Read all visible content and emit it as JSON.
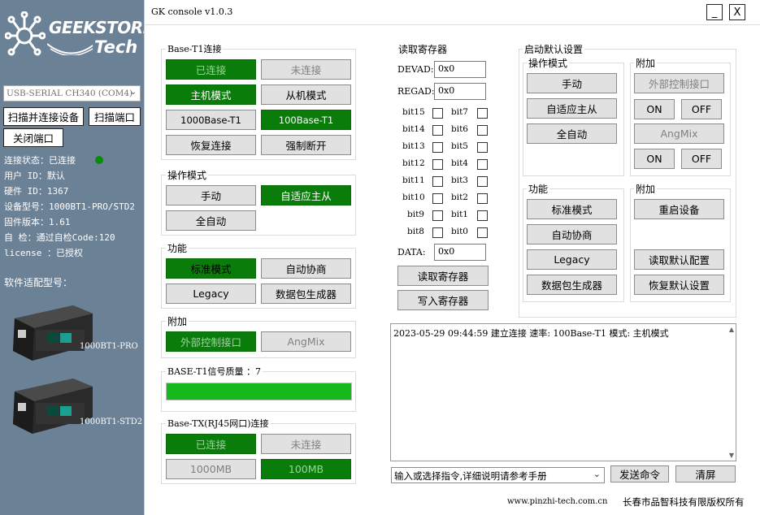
{
  "brand": {
    "line1": "GEEKSTORE",
    "line2": "Tech"
  },
  "window": {
    "title": "GK console v1.0.3",
    "minimize": "_",
    "close": "X"
  },
  "sidebar": {
    "port_select": "USB-SERIAL CH340 (COM4)",
    "scan_connect": "扫描并连接设备",
    "scan_port": "扫描端口",
    "close_port": "关闭端口",
    "info": [
      {
        "k": "连接状态",
        "v": "：已连接"
      },
      {
        "k": "用户  ID",
        "v": "：默认"
      },
      {
        "k": "硬件  ID",
        "v": "：1367"
      },
      {
        "k": "设备型号",
        "v": "：1000BT1-PRO/STD2"
      },
      {
        "k": "固件版本",
        "v": "：1.61"
      },
      {
        "k": "自    检",
        "v": "：通过自检Code:120"
      },
      {
        "k": "license ",
        "v": "：已授权"
      }
    ],
    "models_title": "软件适配型号：",
    "model1": "1000BT1-PRO",
    "model2": "1000BT1-STD2"
  },
  "base_t1": {
    "title": "Base-T1连接",
    "connected": "已连接",
    "disconnected": "未连接",
    "master": "主机模式",
    "slave": "从机模式",
    "speed1000": "1000Base-T1",
    "speed100": "100Base-T1",
    "restore": "恢复连接",
    "force_off": "强制断开"
  },
  "op_mode": {
    "title": "操作模式",
    "manual": "手动",
    "adaptive": "自适应主从",
    "auto": "全自动"
  },
  "func": {
    "title": "功能",
    "standard": "标准模式",
    "autoneg": "自动协商",
    "legacy": "Legacy",
    "pktgen": "数据包生成器"
  },
  "extra": {
    "title": "附加",
    "ext_ctrl": "外部控制接口",
    "angmix": "AngMix"
  },
  "signal": {
    "title": "BASE-T1信号质量 ：7",
    "level": 1.0
  },
  "base_tx": {
    "title": "Base-TX(RJ45网口)连接",
    "connected": "已连接",
    "disconnected": "未连接",
    "speed1000": "1000MB",
    "speed100": "100MB"
  },
  "reg": {
    "title": "读取寄存器",
    "devad_label": "DEVAD:",
    "devad": "0x0",
    "regad_label": "REGAD:",
    "regad": "0x0",
    "bits_left": [
      "bit15",
      "bit14",
      "bit13",
      "bit12",
      "bit11",
      "bit10",
      "bit9",
      "bit8"
    ],
    "bits_right": [
      "bit7",
      "bit6",
      "bit5",
      "bit4",
      "bit3",
      "bit2",
      "bit1",
      "bit0"
    ],
    "data_label": "DATA:",
    "data": "0x0",
    "read": "读取寄存器",
    "write": "写入寄存器"
  },
  "defaults": {
    "title": "启动默认设置",
    "op_title": "操作模式",
    "manual": "手动",
    "adaptive": "自适应主从",
    "auto": "全自动",
    "extra_title": "附加",
    "ext_ctrl": "外部控制接口",
    "on": "ON",
    "off": "OFF",
    "angmix": "AngMix",
    "func_title": "功能",
    "standard": "标准模式",
    "autoneg": "自动协商",
    "legacy": "Legacy",
    "pktgen": "数据包生成器",
    "extra2_title": "附加",
    "reboot": "重启设备",
    "read_default": "读取默认配置",
    "restore_default": "恢复默认设置"
  },
  "log": {
    "line": "2023-05-29 09:44:59 建立连接 速率: 100Base-T1 模式: 主机模式"
  },
  "cmd": {
    "placeholder": "输入或选择指令,详细说明请参考手册",
    "send": "发送命令",
    "clear": "清屏"
  },
  "footer": {
    "site": "www.pinzhi-tech.com.cn",
    "company": "长春市品智科技有限版权所有"
  },
  "colors": {
    "green": "#0a7c0a",
    "sidebar": "#6b8196",
    "progress": "#17b81c"
  }
}
